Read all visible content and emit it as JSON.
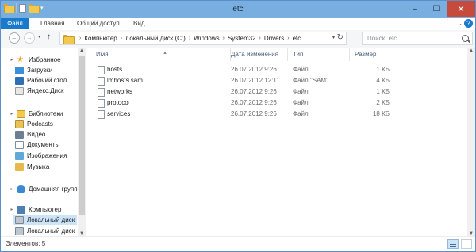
{
  "window": {
    "title": "etc",
    "min": "–",
    "max": "☐",
    "close": "✕"
  },
  "qat": {
    "dropdown": "▾"
  },
  "ribbon": {
    "tabs": [
      "Файл",
      "Главная",
      "Общий доступ",
      "Вид"
    ],
    "expand": "⌄",
    "help": "?"
  },
  "nav": {
    "back": "←",
    "forward": "→",
    "history": "▾",
    "up": "↑",
    "breadcrumb": [
      "Компьютер",
      "Локальный диск (C:)",
      "Windows",
      "System32",
      "Drivers",
      "etc"
    ],
    "separator": "›",
    "dropdown": "▾",
    "refresh": "↻",
    "search_placeholder": "Поиск: etc"
  },
  "navpane": {
    "items": [
      {
        "label": "Избранное",
        "icon": "star-icon",
        "expand": "▸"
      },
      {
        "label": "Загрузки",
        "icon": "downloads-icon"
      },
      {
        "label": "Рабочий стол",
        "icon": "desktop-icon"
      },
      {
        "label": "Яндекс.Диск",
        "icon": "yandex-disk-icon"
      },
      {
        "label": "Библиотеки",
        "icon": "library-icon",
        "expand": "▸"
      },
      {
        "label": "Podcasts",
        "icon": "podcasts-icon"
      },
      {
        "label": "Видео",
        "icon": "video-icon"
      },
      {
        "label": "Документы",
        "icon": "documents-icon"
      },
      {
        "label": "Изображения",
        "icon": "pictures-icon"
      },
      {
        "label": "Музыка",
        "icon": "music-icon"
      },
      {
        "label": "Домашняя группа",
        "icon": "homegroup-icon",
        "expand": "▸"
      },
      {
        "label": "Компьютер",
        "icon": "computer-icon",
        "expand": "▸"
      },
      {
        "label": "Локальный диск",
        "icon": "disk-icon"
      },
      {
        "label": "Локальный диск",
        "icon": "disk-icon"
      }
    ]
  },
  "columns": {
    "name": "Имя",
    "date": "Дата изменения",
    "type": "Тип",
    "size": "Размер",
    "sort_arrow": "▲"
  },
  "files": [
    {
      "name": "hosts",
      "date": "26.07.2012 9:26",
      "type": "Файл",
      "size": "1 КБ"
    },
    {
      "name": "lmhosts.sam",
      "date": "26.07.2012 12:11",
      "type": "Файл \"SAM\"",
      "size": "4 КБ"
    },
    {
      "name": "networks",
      "date": "26.07.2012 9:26",
      "type": "Файл",
      "size": "1 КБ"
    },
    {
      "name": "protocol",
      "date": "26.07.2012 9:26",
      "type": "Файл",
      "size": "2 КБ"
    },
    {
      "name": "services",
      "date": "26.07.2012 9:26",
      "type": "Файл",
      "size": "18 КБ"
    }
  ],
  "scroll": {
    "up": "▲",
    "down": "▼"
  },
  "status": {
    "text": "Элементов: 5"
  }
}
